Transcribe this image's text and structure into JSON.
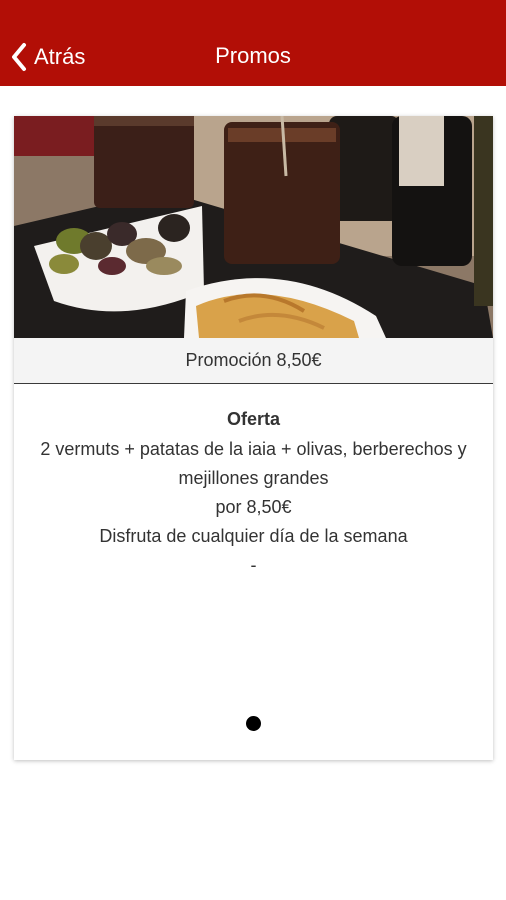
{
  "header": {
    "back_label": "Atrás",
    "title": "Promos",
    "color": "#b20e06"
  },
  "promo": {
    "image": "vermouth glasses, bowl of olives with mussels and cockles, bowl of potato chips",
    "label": "Promoción 8,50€",
    "offer_title": "Oferta",
    "description": "2 vermuts + patatas de la iaia + olivas, berberechos y mejillones grandes",
    "price_line": "por 8,50€",
    "validity": "Disfruta de cualquier día de la semana",
    "extra": "-"
  },
  "pager": {
    "current": 1,
    "total": 1
  }
}
